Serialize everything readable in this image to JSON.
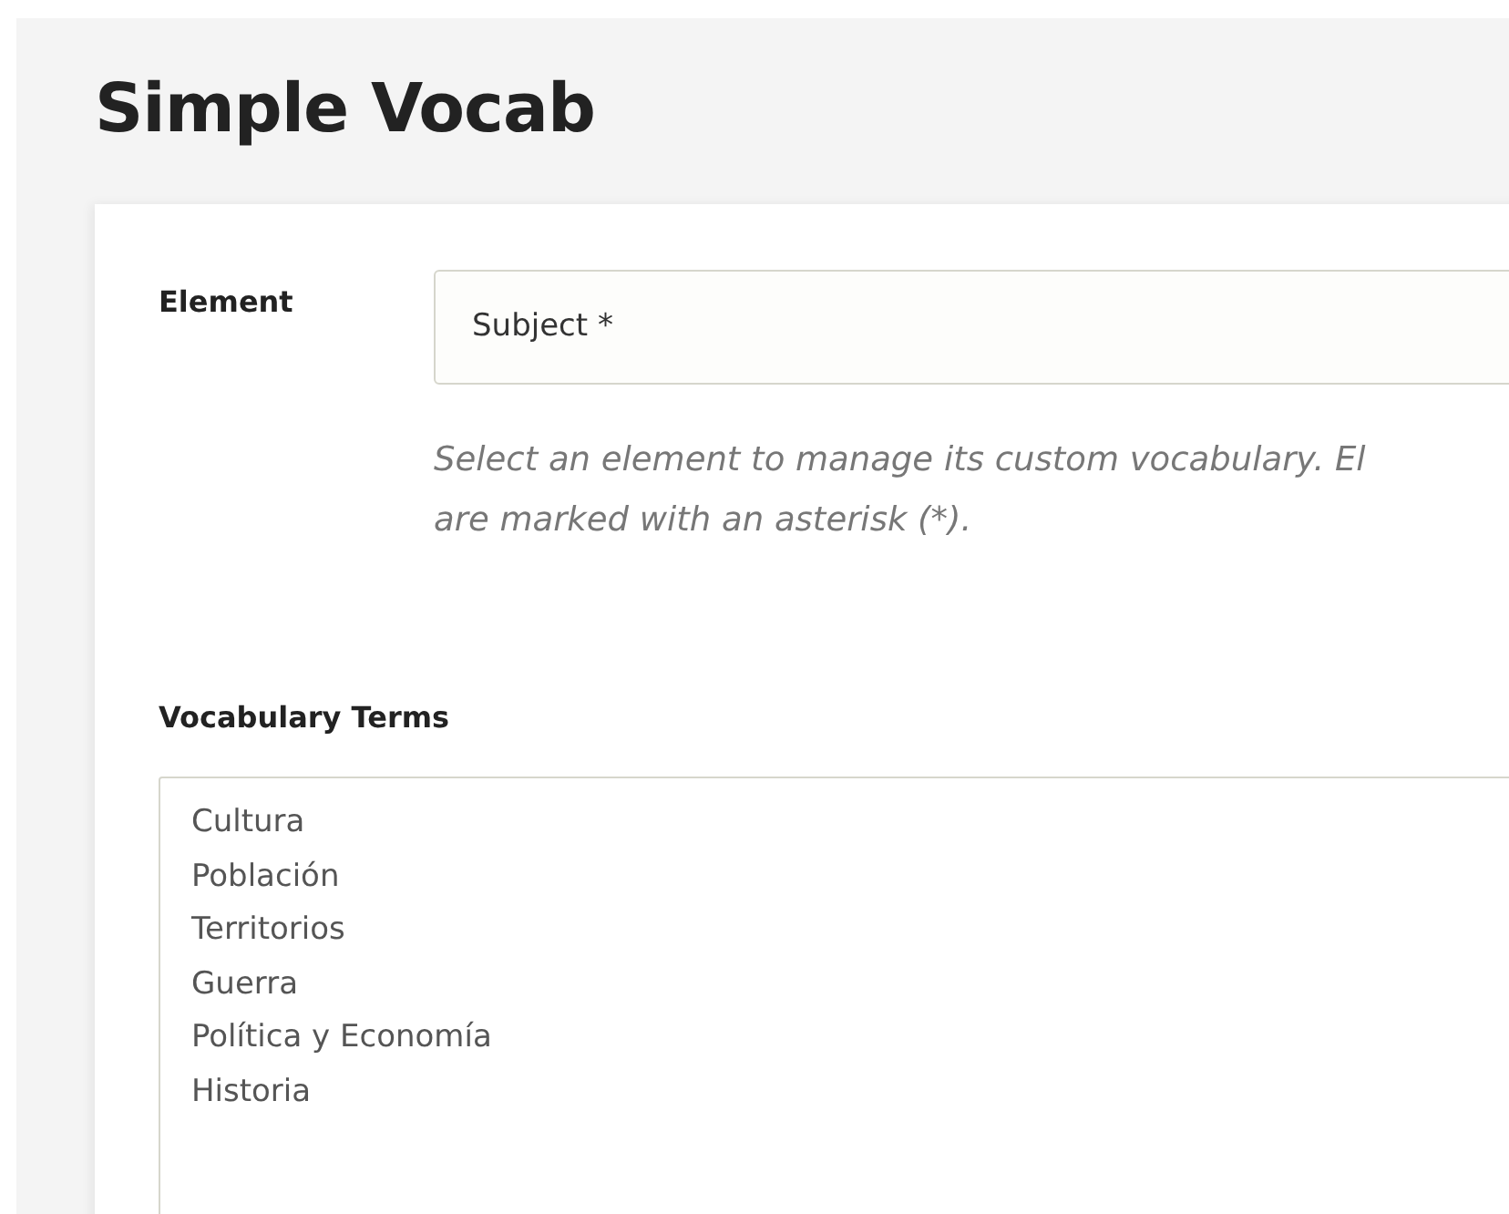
{
  "page": {
    "title": "Simple Vocab"
  },
  "element_field": {
    "label": "Element",
    "value": "Subject *"
  },
  "help_lines": [
    "Select an element to manage its custom vocabulary. El",
    "are marked with an asterisk (*)."
  ],
  "terms_field": {
    "label": "Vocabulary Terms",
    "terms": [
      "Cultura",
      "Población",
      "Territorios",
      "Guerra",
      "Política y Economía",
      "Historia"
    ]
  }
}
